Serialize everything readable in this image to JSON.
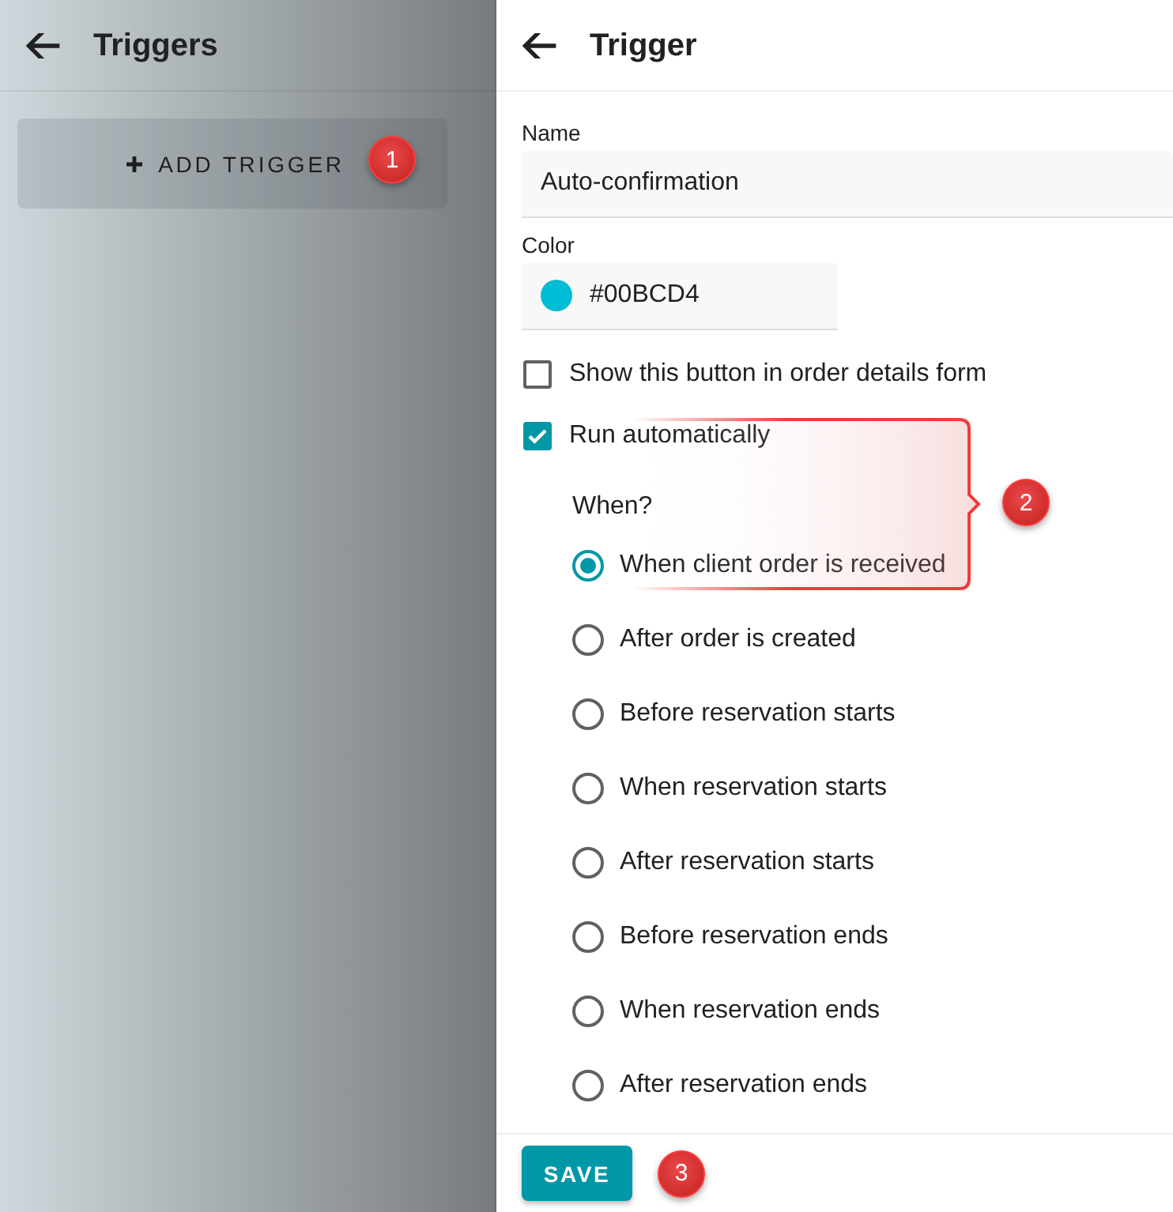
{
  "sidebar": {
    "title": "Triggers",
    "add_button": {
      "label": "ADD TRIGGER"
    },
    "marker": "1"
  },
  "panel": {
    "title": "Trigger",
    "name_field": {
      "label": "Name",
      "value": "Auto-confirmation"
    },
    "color_field": {
      "label": "Color",
      "value": "#00BCD4",
      "color": "#00bcd4"
    },
    "checkboxes": [
      {
        "label": "Show this button in order details form",
        "checked": false
      },
      {
        "label": "Run automatically",
        "checked": true
      }
    ],
    "when": {
      "label": "When?",
      "options": [
        {
          "label": "When client order is received",
          "selected": true
        },
        {
          "label": "After order is created",
          "selected": false
        },
        {
          "label": "Before reservation starts",
          "selected": false
        },
        {
          "label": "When reservation starts",
          "selected": false
        },
        {
          "label": "After reservation starts",
          "selected": false
        },
        {
          "label": "Before reservation ends",
          "selected": false
        },
        {
          "label": "When reservation ends",
          "selected": false
        },
        {
          "label": "After reservation ends",
          "selected": false
        }
      ]
    },
    "callout": {
      "marker": "2"
    }
  },
  "footer": {
    "save_button": {
      "label": "SAVE"
    },
    "marker": "3"
  }
}
